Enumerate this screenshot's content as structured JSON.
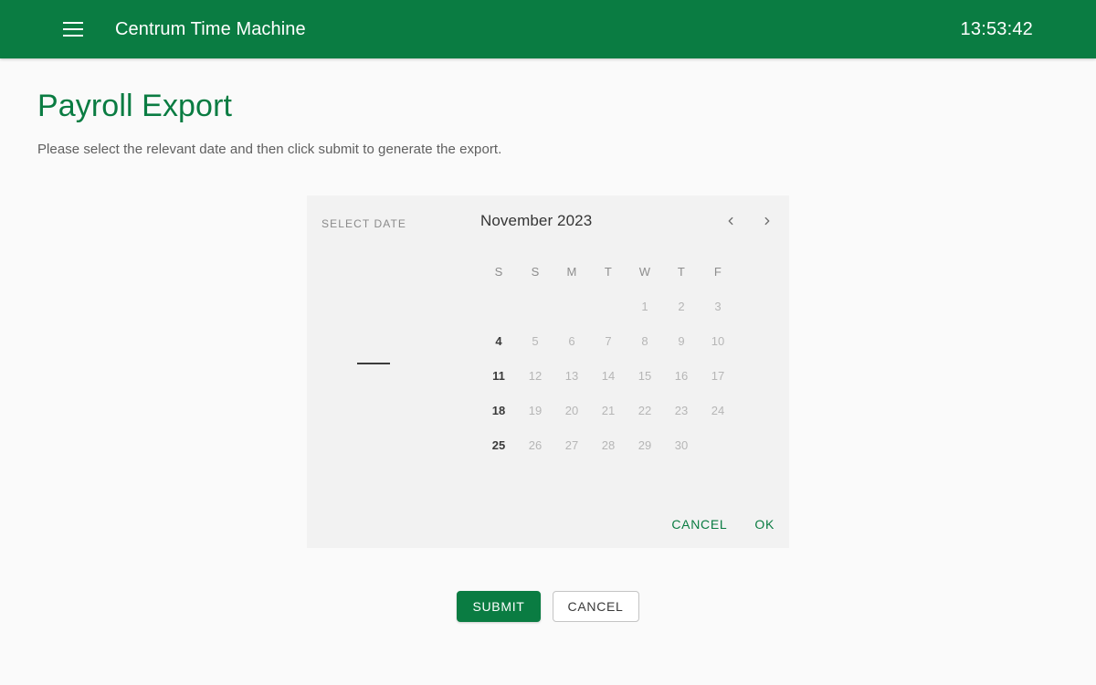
{
  "appbar": {
    "menu_icon": "hamburger-menu-icon",
    "title": "Centrum Time Machine",
    "clock": "13:53:42",
    "background_color": "#0a7c42",
    "text_color": "#ffffff"
  },
  "page": {
    "title": "Payroll Export",
    "title_color": "#0a7c42",
    "subtitle": "Please select the relevant date and then click submit to generate the export.",
    "background_color": "#fafafa"
  },
  "datepicker": {
    "card_background": "#f2f2f2",
    "side_label": "SELECT DATE",
    "selected_value": "",
    "selected_placeholder": "—",
    "month_label": "November 2023",
    "prev_icon": "chevron-left-icon",
    "next_icon": "chevron-right-icon",
    "weekday_headers": [
      "S",
      "S",
      "M",
      "T",
      "W",
      "T",
      "F"
    ],
    "leading_blanks": 4,
    "days": [
      {
        "label": "1",
        "enabled": false
      },
      {
        "label": "2",
        "enabled": false
      },
      {
        "label": "3",
        "enabled": false
      },
      {
        "label": "4",
        "enabled": true
      },
      {
        "label": "5",
        "enabled": false
      },
      {
        "label": "6",
        "enabled": false
      },
      {
        "label": "7",
        "enabled": false
      },
      {
        "label": "8",
        "enabled": false
      },
      {
        "label": "9",
        "enabled": false
      },
      {
        "label": "10",
        "enabled": false
      },
      {
        "label": "11",
        "enabled": true
      },
      {
        "label": "12",
        "enabled": false
      },
      {
        "label": "13",
        "enabled": false
      },
      {
        "label": "14",
        "enabled": false
      },
      {
        "label": "15",
        "enabled": false
      },
      {
        "label": "16",
        "enabled": false
      },
      {
        "label": "17",
        "enabled": false
      },
      {
        "label": "18",
        "enabled": true
      },
      {
        "label": "19",
        "enabled": false
      },
      {
        "label": "20",
        "enabled": false
      },
      {
        "label": "21",
        "enabled": false
      },
      {
        "label": "22",
        "enabled": false
      },
      {
        "label": "23",
        "enabled": false
      },
      {
        "label": "24",
        "enabled": false
      },
      {
        "label": "25",
        "enabled": true
      },
      {
        "label": "26",
        "enabled": false
      },
      {
        "label": "27",
        "enabled": false
      },
      {
        "label": "28",
        "enabled": false
      },
      {
        "label": "29",
        "enabled": false
      },
      {
        "label": "30",
        "enabled": false
      }
    ],
    "cancel_label": "CANCEL",
    "ok_label": "OK",
    "action_color": "#0a7c42"
  },
  "bottom_actions": {
    "submit_label": "SUBMIT",
    "cancel_label": "CANCEL",
    "submit_color": "#0a7c42"
  }
}
